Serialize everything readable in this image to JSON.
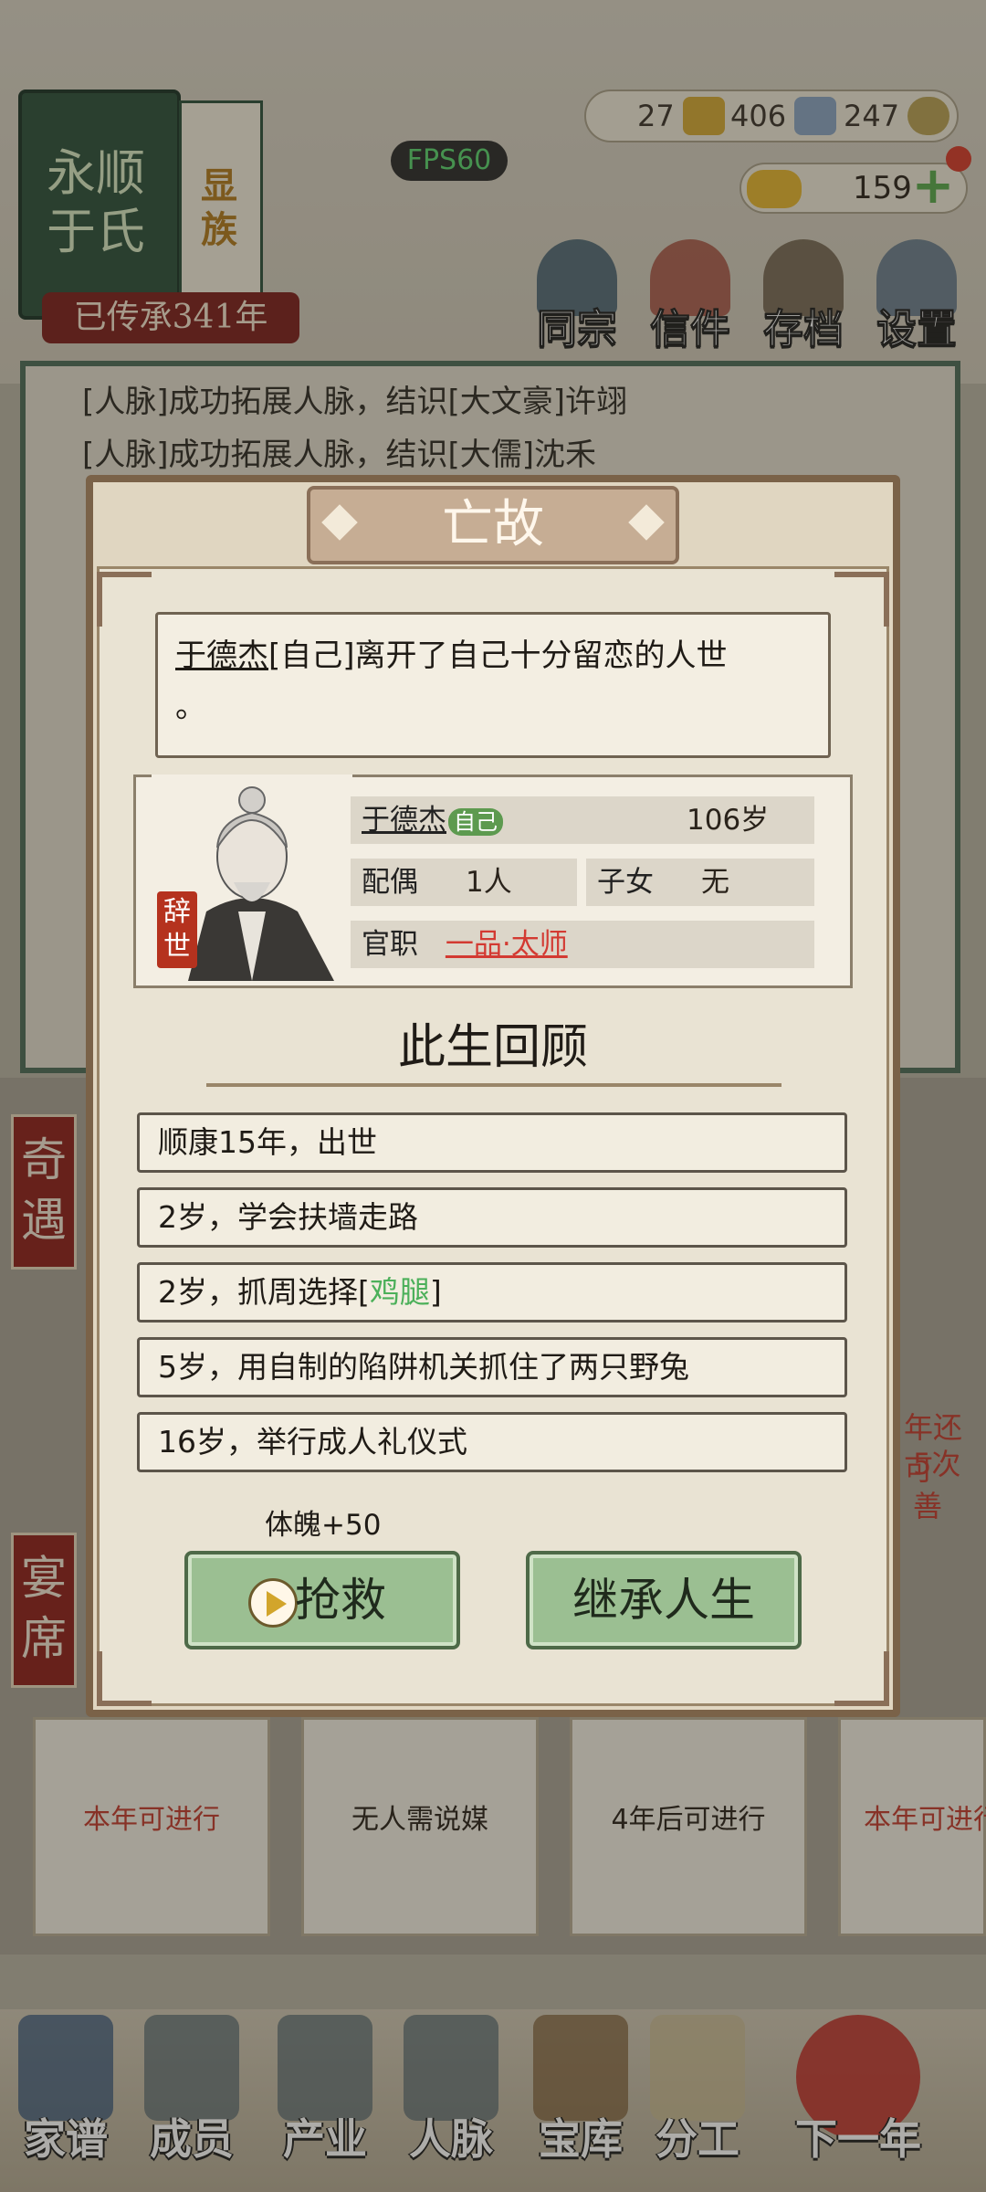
{
  "clan": {
    "name_line1": "永顺",
    "name_line2": "于氏",
    "status": "显族",
    "heritage": "已传承341年"
  },
  "fps": "FPS60",
  "resources": {
    "r1": "27",
    "r2": "406",
    "r3": "247",
    "gold": "159"
  },
  "top_menu": [
    "同宗",
    "信件",
    "存档",
    "设置"
  ],
  "log": {
    "line1": "[人脉]成功拓展人脉，结识[大文豪]许翊",
    "line2": "[人脉]成功拓展人脉，结识[大儒]沈禾"
  },
  "side_tags": {
    "a": "奇遇",
    "b": "宴席"
  },
  "event_cards": [
    "本年可进行",
    "无人需说媒",
    "4年后可进行",
    "本年可进行"
  ],
  "behind_text": {
    "a": "年还可",
    "b": "5次善"
  },
  "bottom_nav": [
    "家谱",
    "成员",
    "产业",
    "人脉",
    "宝库",
    "分工",
    "下一年"
  ],
  "modal": {
    "title": "亡故",
    "message_name": "于德杰",
    "message_rest": "[自己]离开了自己十分留恋的人世",
    "message_tail": "。",
    "person": {
      "name": "于德杰",
      "self_tag": "自己",
      "age": "106岁",
      "spouse_label": "配偶",
      "spouse": "1人",
      "children_label": "子女",
      "children": "无",
      "office_label": "官职",
      "office": "一品·太师",
      "seal": "辞世"
    },
    "review_title": "此生回顾",
    "life": [
      {
        "pre": "顺康15年，出世",
        "hl": "",
        "post": ""
      },
      {
        "pre": "2岁，学会扶墙走路",
        "hl": "",
        "post": ""
      },
      {
        "pre": "2岁，抓周选择[",
        "hl": "鸡腿",
        "post": "]"
      },
      {
        "pre": "5岁，用自制的陷阱机关抓住了两只野兔",
        "hl": "",
        "post": ""
      },
      {
        "pre": "16岁，举行成人礼仪式",
        "hl": "",
        "post": ""
      }
    ],
    "attribute": "体魄+50",
    "rescue_button": "抢救",
    "inherit_button": "继承人生"
  }
}
